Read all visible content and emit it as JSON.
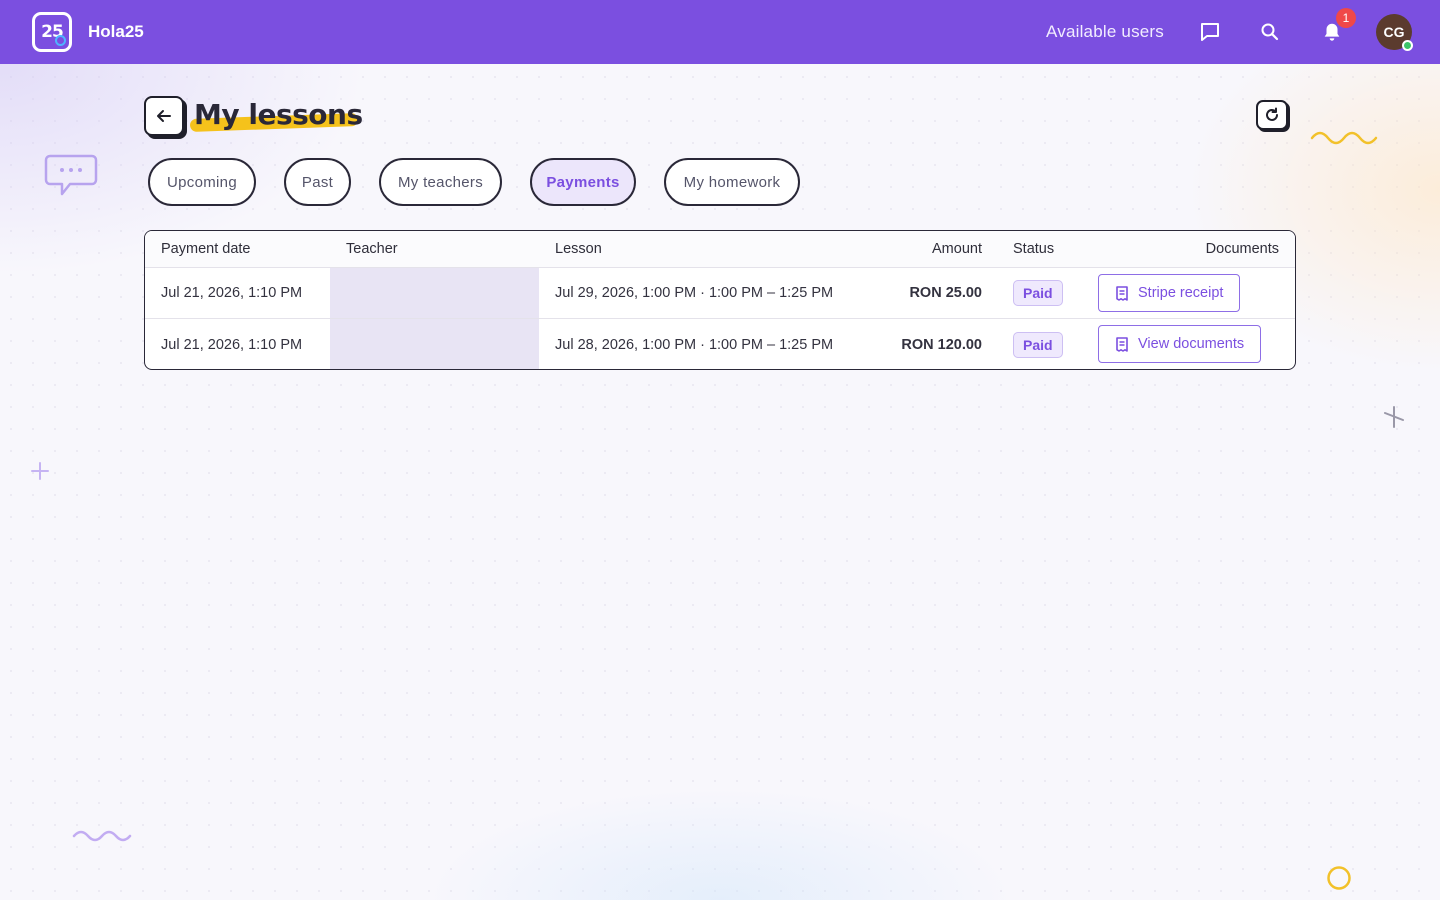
{
  "app": {
    "logo_text": "25",
    "name": "Hola25"
  },
  "topbar": {
    "available_users": "Available users",
    "notification_count": "1",
    "avatar_initials": "CG"
  },
  "page": {
    "title": "My lessons"
  },
  "tabs": [
    {
      "label": "Upcoming",
      "active": false
    },
    {
      "label": "Past",
      "active": false
    },
    {
      "label": "My teachers",
      "active": false
    },
    {
      "label": "Payments",
      "active": true
    },
    {
      "label": "My homework",
      "active": false
    }
  ],
  "table": {
    "headers": {
      "payment_date": "Payment date",
      "teacher": "Teacher",
      "lesson": "Lesson",
      "amount": "Amount",
      "status": "Status",
      "documents": "Documents"
    },
    "rows": [
      {
        "payment_date": "Jul 21, 2026, 1:10 PM",
        "teacher": "",
        "lesson": "Jul 29, 2026, 1:00 PM · 1:00 PM – 1:25 PM",
        "amount": "RON 25.00",
        "status": "Paid",
        "document_label": "Stripe receipt"
      },
      {
        "payment_date": "Jul 21, 2026, 1:10 PM",
        "teacher": "",
        "lesson": "Jul 28, 2026, 1:00 PM · 1:00 PM – 1:25 PM",
        "amount": "RON 120.00",
        "status": "Paid",
        "document_label": "View documents"
      }
    ]
  },
  "colors": {
    "brand": "#7b4fe0",
    "highlight": "#f5c21b",
    "badge": "#f04848",
    "online": "#3cc46a"
  },
  "icons": [
    "chat-icon",
    "search-icon",
    "bell-icon",
    "back-arrow-icon",
    "refresh-icon",
    "receipt-icon"
  ]
}
